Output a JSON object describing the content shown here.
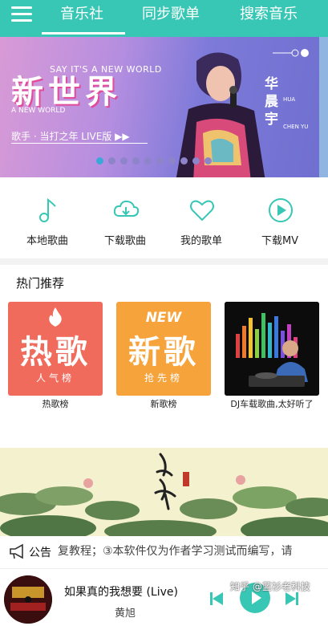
{
  "nav": {
    "tabs": [
      {
        "label": "音乐社",
        "active": true
      },
      {
        "label": "同步歌单",
        "active": false
      },
      {
        "label": "搜索音乐",
        "active": false
      }
    ],
    "accent_color": "#38c7b4"
  },
  "banner": {
    "title": "新世界",
    "subtitle_en": "SAY IT'S A NEW WORLD",
    "small_en": "A NEW WORLD",
    "caption": "歌手 · 当打之年 LIVE版 ▶▶",
    "artist": "华晨宇",
    "artist_en": "HUA",
    "artist_en2": "CHEN YU",
    "dot_count": 10,
    "active_dot": 0
  },
  "actions": [
    {
      "label": "本地歌曲",
      "icon": "music-note-icon"
    },
    {
      "label": "下载歌曲",
      "icon": "cloud-download-icon"
    },
    {
      "label": "我的歌单",
      "icon": "heart-icon"
    },
    {
      "label": "下载MV",
      "icon": "play-circle-icon"
    }
  ],
  "hot": {
    "section_title": "热门推荐",
    "cards": [
      {
        "cover_big": "热歌",
        "cover_small": "人气榜",
        "caption": "热歌榜"
      },
      {
        "cover_tag": "NEW",
        "cover_big": "新歌",
        "cover_small": "抢先榜",
        "caption": "新歌榜"
      },
      {
        "caption": "DJ车载歌曲,太好听了"
      }
    ]
  },
  "lotus_banner": {
    "calligraphy": "西施"
  },
  "notice": {
    "label": "公告",
    "text": "复教程；③本软件仅为作者学习测试而编写，请"
  },
  "player": {
    "title": "如果真的我想要 (Live)",
    "artist": "黄旭",
    "watermark": "知乎 @蓝衫老科技"
  }
}
